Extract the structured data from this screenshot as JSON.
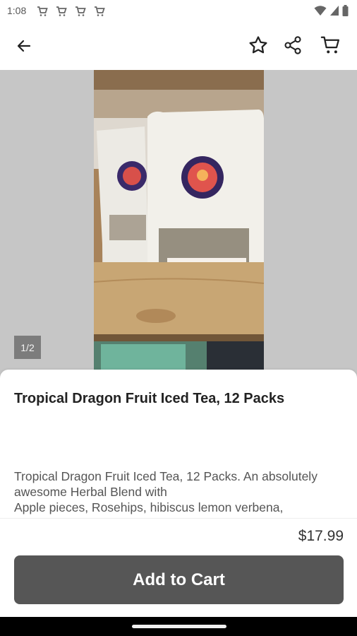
{
  "status_bar": {
    "time": "1:08",
    "notification_icons": [
      "cart-icon",
      "cart-icon",
      "cart-icon",
      "cart-icon"
    ],
    "right_icons": [
      "wifi-icon",
      "signal-icon",
      "battery-icon"
    ]
  },
  "top_bar": {
    "back_icon": "arrow-left-icon",
    "actions": [
      "star-outline-icon",
      "share-icon",
      "cart-icon"
    ]
  },
  "gallery": {
    "page_indicator": "1/2"
  },
  "product": {
    "title": "Tropical Dragon Fruit Iced Tea, 12 Packs",
    "description": "Tropical Dragon Fruit Iced Tea, 12 Packs. An absolutely\nawesome Herbal Blend with\nApple pieces, Rosehips, hibiscus lemon verbena,\norange peel, rose fruit & marula fruit",
    "price": "$17.99"
  },
  "cta": {
    "add_to_cart_label": "Add to Cart"
  },
  "colors": {
    "cta_background": "#565656",
    "hero_background": "#c6c6c6"
  }
}
